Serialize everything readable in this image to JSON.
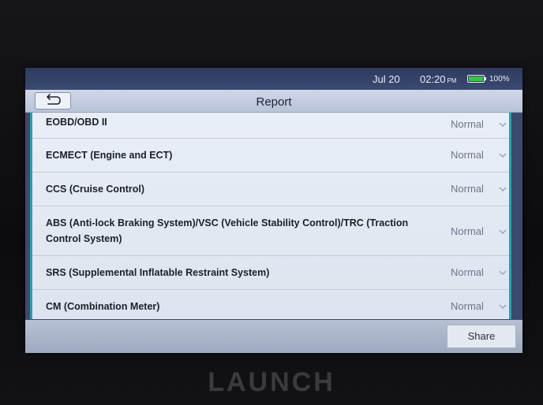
{
  "status_bar": {
    "date": "Jul 20",
    "time": "02:20",
    "ampm": "PM",
    "battery_percent": "100%",
    "battery_level": 1.0
  },
  "header": {
    "title": "Report",
    "back_icon": "back-arrow-icon"
  },
  "report": {
    "items": [
      {
        "label": "EOBD/OBD II",
        "status": "Normal"
      },
      {
        "label": "ECMECT (Engine and ECT)",
        "status": "Normal"
      },
      {
        "label": "CCS (Cruise Control)",
        "status": "Normal"
      },
      {
        "label": "ABS (Anti-lock Braking System)/VSC (Vehicle Stability Control)/TRC (Traction Control System)",
        "status": "Normal"
      },
      {
        "label": "SRS (Supplemental Inflatable Restraint System)",
        "status": "Normal"
      },
      {
        "label": "CM (Combination Meter)",
        "status": "Normal"
      }
    ]
  },
  "footer": {
    "share_label": "Share"
  },
  "device": {
    "brand": "LAUNCH"
  },
  "colors": {
    "accent": "#2b9db0",
    "battery": "#37c24a"
  }
}
